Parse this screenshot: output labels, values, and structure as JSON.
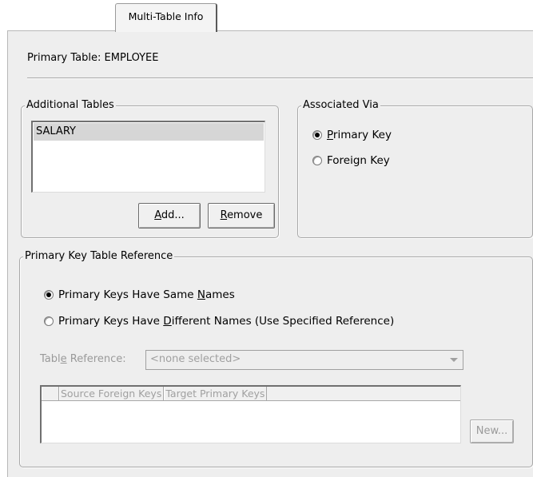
{
  "tab": {
    "label": "Multi-Table Info"
  },
  "primary_table": {
    "label": "Primary Table:",
    "value": "EMPLOYEE"
  },
  "additional_tables": {
    "legend": "Additional Tables",
    "items": [
      "SALARY"
    ],
    "add_button": {
      "prefix": "",
      "mnemonic": "A",
      "rest": "dd..."
    },
    "remove_button": {
      "prefix": "",
      "mnemonic": "R",
      "rest": "emove"
    }
  },
  "associated_via": {
    "legend": "Associated Via",
    "options": [
      {
        "prefix": "",
        "mnemonic": "P",
        "rest": "rimary Key",
        "checked": true
      },
      {
        "prefix": "",
        "mnemonic": "",
        "rest": "Foreign Key",
        "checked": false
      }
    ]
  },
  "pk_reference": {
    "legend": "Primary Key Table Reference",
    "options": [
      {
        "prefix": "Primary Keys Have Same ",
        "mnemonic": "N",
        "rest": "ames",
        "checked": true
      },
      {
        "prefix": "Primary Keys Have ",
        "mnemonic": "D",
        "rest": "ifferent Names (Use Specified Reference)",
        "checked": false
      }
    ],
    "table_reference": {
      "prefix": "Tabl",
      "mnemonic": "e",
      "rest": " Reference:",
      "selected": "<none selected>"
    },
    "columns": [
      "Source Foreign Keys",
      "Target Primary Keys"
    ],
    "new_button": {
      "prefix": "",
      "mnemonic": "",
      "rest": "New..."
    }
  }
}
